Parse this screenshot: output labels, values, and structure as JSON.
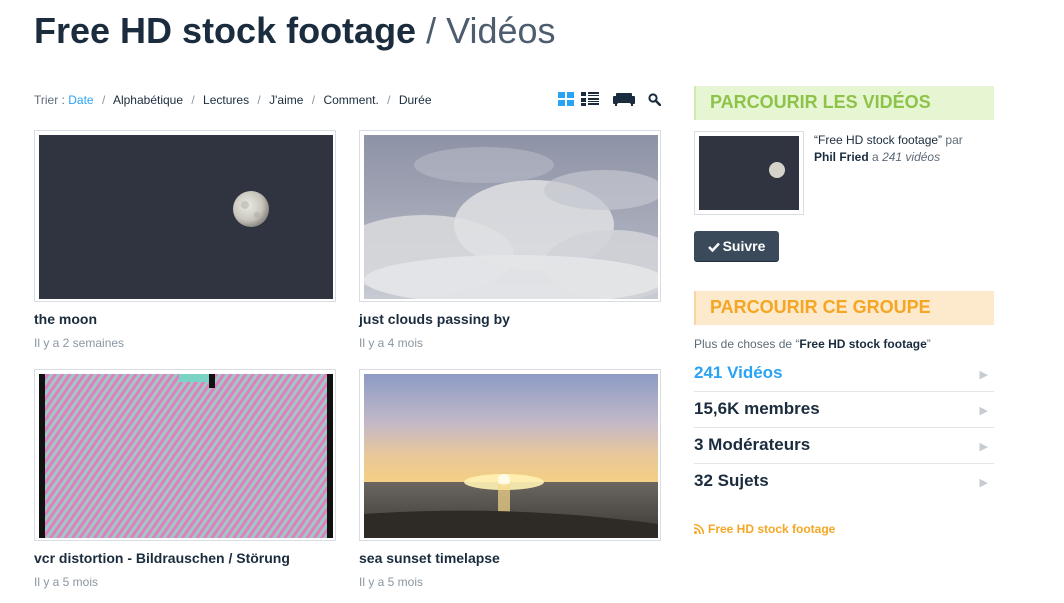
{
  "header": {
    "group_name": "Free HD stock footage",
    "section": "/ Vidéos"
  },
  "sort": {
    "label": "Trier :",
    "options": [
      "Date",
      "Alphabétique",
      "Lectures",
      "J'aime",
      "Comment.",
      "Durée"
    ],
    "active": "Date"
  },
  "videos": [
    {
      "title": "the moon",
      "date": "Il y a 2 semaines"
    },
    {
      "title": "just clouds passing by",
      "date": "Il y a 4 mois"
    },
    {
      "title": "vcr distortion - Bildrauschen / Störung",
      "date": "Il y a 5 mois"
    },
    {
      "title": "sea sunset timelapse",
      "date": "Il y a 5 mois"
    }
  ],
  "sidebar": {
    "browse_heading": "PARCOURIR LES VIDÉOS",
    "owner": {
      "group_quote": "“Free HD stock footage”",
      "by": "par",
      "name": "Phil Fried",
      "a": "a",
      "count": "241 vidéos"
    },
    "follow_label": "Suivre",
    "group_heading": "PARCOURIR CE GROUPE",
    "intro_prefix": "Plus de choses de “",
    "intro_name": "Free HD stock footage",
    "intro_suffix": "”",
    "stats": [
      "241 Vidéos",
      "15,6K membres",
      "3 Modérateurs",
      "32 Sujets"
    ],
    "rss_label": "Free HD stock footage"
  },
  "colors": {
    "accent_blue": "#2aa3f5",
    "green_heading": "#8ec34a",
    "orange_heading": "#f5a623",
    "dark_button": "#3a4a5b"
  },
  "icons": [
    "grid-view-icon",
    "list-view-icon",
    "couch-icon",
    "search-icon",
    "check-icon",
    "rss-icon",
    "arrow-right-icon"
  ]
}
